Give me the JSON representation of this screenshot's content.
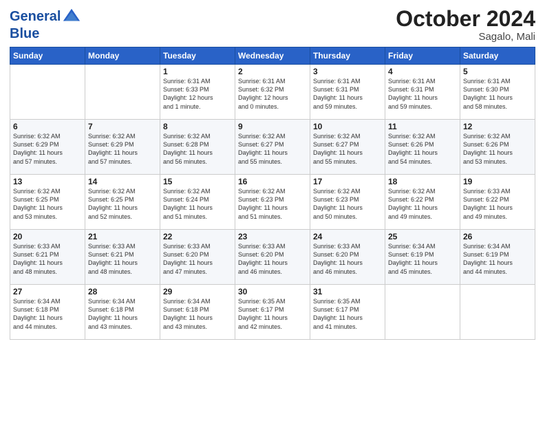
{
  "logo": {
    "line1": "General",
    "line2": "Blue"
  },
  "header": {
    "month": "October 2024",
    "location": "Sagalo, Mali"
  },
  "weekdays": [
    "Sunday",
    "Monday",
    "Tuesday",
    "Wednesday",
    "Thursday",
    "Friday",
    "Saturday"
  ],
  "weeks": [
    [
      {
        "day": "",
        "info": ""
      },
      {
        "day": "",
        "info": ""
      },
      {
        "day": "1",
        "info": "Sunrise: 6:31 AM\nSunset: 6:33 PM\nDaylight: 12 hours\nand 1 minute."
      },
      {
        "day": "2",
        "info": "Sunrise: 6:31 AM\nSunset: 6:32 PM\nDaylight: 12 hours\nand 0 minutes."
      },
      {
        "day": "3",
        "info": "Sunrise: 6:31 AM\nSunset: 6:31 PM\nDaylight: 11 hours\nand 59 minutes."
      },
      {
        "day": "4",
        "info": "Sunrise: 6:31 AM\nSunset: 6:31 PM\nDaylight: 11 hours\nand 59 minutes."
      },
      {
        "day": "5",
        "info": "Sunrise: 6:31 AM\nSunset: 6:30 PM\nDaylight: 11 hours\nand 58 minutes."
      }
    ],
    [
      {
        "day": "6",
        "info": "Sunrise: 6:32 AM\nSunset: 6:29 PM\nDaylight: 11 hours\nand 57 minutes."
      },
      {
        "day": "7",
        "info": "Sunrise: 6:32 AM\nSunset: 6:29 PM\nDaylight: 11 hours\nand 57 minutes."
      },
      {
        "day": "8",
        "info": "Sunrise: 6:32 AM\nSunset: 6:28 PM\nDaylight: 11 hours\nand 56 minutes."
      },
      {
        "day": "9",
        "info": "Sunrise: 6:32 AM\nSunset: 6:27 PM\nDaylight: 11 hours\nand 55 minutes."
      },
      {
        "day": "10",
        "info": "Sunrise: 6:32 AM\nSunset: 6:27 PM\nDaylight: 11 hours\nand 55 minutes."
      },
      {
        "day": "11",
        "info": "Sunrise: 6:32 AM\nSunset: 6:26 PM\nDaylight: 11 hours\nand 54 minutes."
      },
      {
        "day": "12",
        "info": "Sunrise: 6:32 AM\nSunset: 6:26 PM\nDaylight: 11 hours\nand 53 minutes."
      }
    ],
    [
      {
        "day": "13",
        "info": "Sunrise: 6:32 AM\nSunset: 6:25 PM\nDaylight: 11 hours\nand 53 minutes."
      },
      {
        "day": "14",
        "info": "Sunrise: 6:32 AM\nSunset: 6:25 PM\nDaylight: 11 hours\nand 52 minutes."
      },
      {
        "day": "15",
        "info": "Sunrise: 6:32 AM\nSunset: 6:24 PM\nDaylight: 11 hours\nand 51 minutes."
      },
      {
        "day": "16",
        "info": "Sunrise: 6:32 AM\nSunset: 6:23 PM\nDaylight: 11 hours\nand 51 minutes."
      },
      {
        "day": "17",
        "info": "Sunrise: 6:32 AM\nSunset: 6:23 PM\nDaylight: 11 hours\nand 50 minutes."
      },
      {
        "day": "18",
        "info": "Sunrise: 6:32 AM\nSunset: 6:22 PM\nDaylight: 11 hours\nand 49 minutes."
      },
      {
        "day": "19",
        "info": "Sunrise: 6:33 AM\nSunset: 6:22 PM\nDaylight: 11 hours\nand 49 minutes."
      }
    ],
    [
      {
        "day": "20",
        "info": "Sunrise: 6:33 AM\nSunset: 6:21 PM\nDaylight: 11 hours\nand 48 minutes."
      },
      {
        "day": "21",
        "info": "Sunrise: 6:33 AM\nSunset: 6:21 PM\nDaylight: 11 hours\nand 48 minutes."
      },
      {
        "day": "22",
        "info": "Sunrise: 6:33 AM\nSunset: 6:20 PM\nDaylight: 11 hours\nand 47 minutes."
      },
      {
        "day": "23",
        "info": "Sunrise: 6:33 AM\nSunset: 6:20 PM\nDaylight: 11 hours\nand 46 minutes."
      },
      {
        "day": "24",
        "info": "Sunrise: 6:33 AM\nSunset: 6:20 PM\nDaylight: 11 hours\nand 46 minutes."
      },
      {
        "day": "25",
        "info": "Sunrise: 6:34 AM\nSunset: 6:19 PM\nDaylight: 11 hours\nand 45 minutes."
      },
      {
        "day": "26",
        "info": "Sunrise: 6:34 AM\nSunset: 6:19 PM\nDaylight: 11 hours\nand 44 minutes."
      }
    ],
    [
      {
        "day": "27",
        "info": "Sunrise: 6:34 AM\nSunset: 6:18 PM\nDaylight: 11 hours\nand 44 minutes."
      },
      {
        "day": "28",
        "info": "Sunrise: 6:34 AM\nSunset: 6:18 PM\nDaylight: 11 hours\nand 43 minutes."
      },
      {
        "day": "29",
        "info": "Sunrise: 6:34 AM\nSunset: 6:18 PM\nDaylight: 11 hours\nand 43 minutes."
      },
      {
        "day": "30",
        "info": "Sunrise: 6:35 AM\nSunset: 6:17 PM\nDaylight: 11 hours\nand 42 minutes."
      },
      {
        "day": "31",
        "info": "Sunrise: 6:35 AM\nSunset: 6:17 PM\nDaylight: 11 hours\nand 41 minutes."
      },
      {
        "day": "",
        "info": ""
      },
      {
        "day": "",
        "info": ""
      }
    ]
  ]
}
